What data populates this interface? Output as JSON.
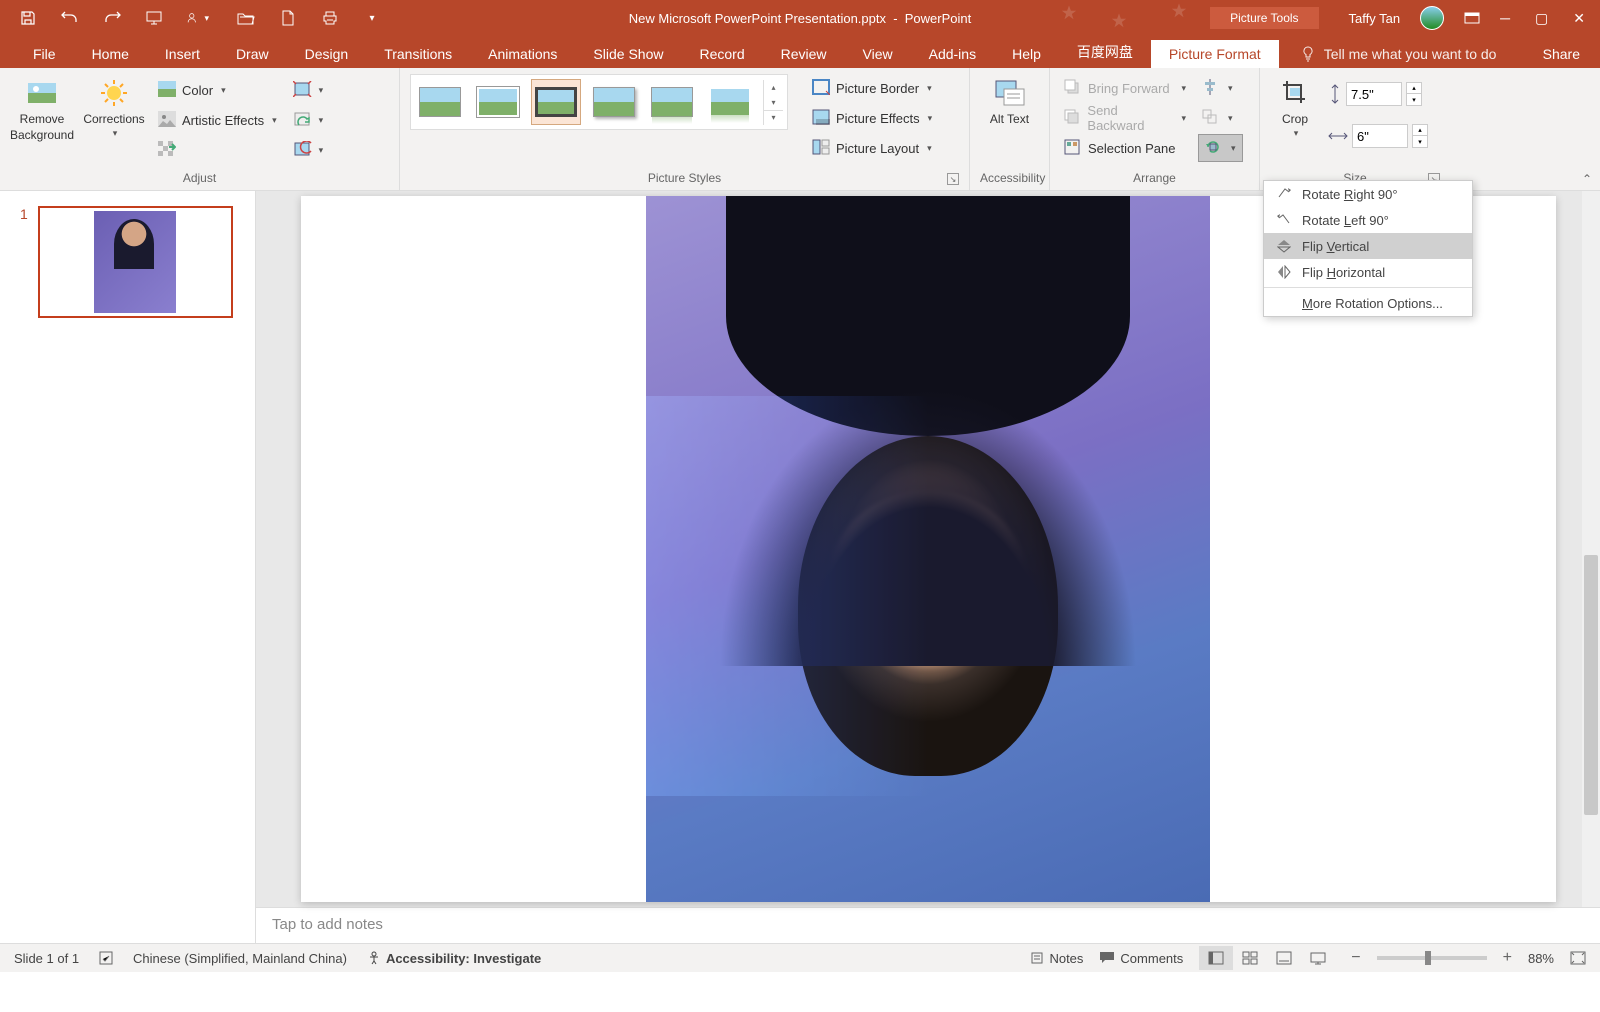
{
  "title": {
    "filename": "New Microsoft PowerPoint Presentation.pptx",
    "app": "PowerPoint",
    "tool_tab": "Picture Tools",
    "user": "Taffy Tan"
  },
  "tabs": {
    "file": "File",
    "home": "Home",
    "insert": "Insert",
    "draw": "Draw",
    "design": "Design",
    "transitions": "Transitions",
    "animations": "Animations",
    "slideshow": "Slide Show",
    "record": "Record",
    "review": "Review",
    "view": "View",
    "addins": "Add-ins",
    "help": "Help",
    "baidu": "百度网盘",
    "picfmt": "Picture Format",
    "tellme": "Tell me what you want to do",
    "share": "Share"
  },
  "ribbon": {
    "remove_bg": "Remove Background",
    "corrections": "Corrections",
    "color": "Color",
    "artistic": "Artistic Effects",
    "adjust_label": "Adjust",
    "styles_label": "Picture Styles",
    "border": "Picture Border",
    "effects": "Picture Effects",
    "layout": "Picture Layout",
    "alt": "Alt Text",
    "accessibility_label": "Accessibility",
    "bring": "Bring Forward",
    "send": "Send Backward",
    "selpane": "Selection Pane",
    "arrange_label": "Arrange",
    "crop": "Crop",
    "height": "7.5\"",
    "width": "6\"",
    "size_label": "Size"
  },
  "rotate_menu": {
    "r_right": "Rotate Right 90°",
    "r_left": "Rotate Left 90°",
    "flip_v": "Flip Vertical",
    "flip_h": "Flip Horizontal",
    "more": "More Rotation Options..."
  },
  "thumbs": {
    "num": "1"
  },
  "notes": {
    "placeholder": "Tap to add notes"
  },
  "status": {
    "slide": "Slide 1 of 1",
    "lang": "Chinese (Simplified, Mainland China)",
    "access": "Accessibility: Investigate",
    "notes": "Notes",
    "comments": "Comments",
    "zoom": "88%"
  }
}
